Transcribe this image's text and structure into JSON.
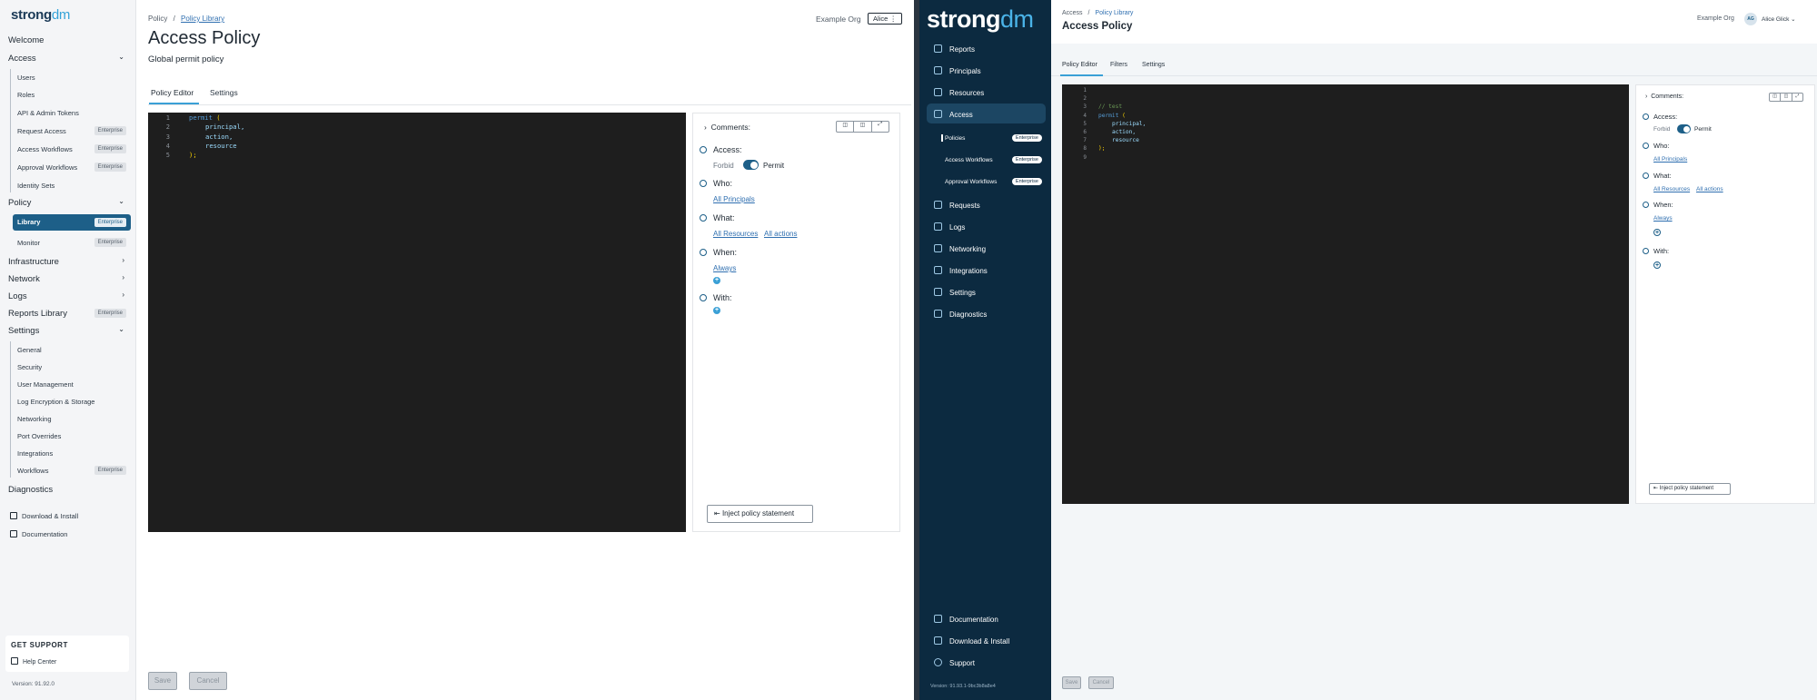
{
  "left": {
    "logo": {
      "a": "strong",
      "b": "dm"
    },
    "nav": {
      "welcome": "Welcome",
      "access": "Access",
      "access_items": [
        "Users",
        "Roles",
        "API & Admin Tokens",
        "Request Access",
        "Access Workflows",
        "Approval Workflows",
        "Identity Sets"
      ],
      "policy": "Policy",
      "policy_items": [
        "Library",
        "Monitor"
      ],
      "infrastructure": "Infrastructure",
      "network": "Network",
      "logs": "Logs",
      "reports_library": "Reports Library",
      "settings": "Settings",
      "settings_items": [
        "General",
        "Security",
        "User Management",
        "Log Encryption & Storage",
        "Networking",
        "Port Overrides",
        "Integrations",
        "Workflows"
      ],
      "diagnostics": "Diagnostics",
      "download": "Download & Install",
      "documentation": "Documentation",
      "enterprise": "Enterprise"
    },
    "support": {
      "title": "GET SUPPORT",
      "help": "Help Center"
    },
    "version": "Version: 91.92.0",
    "breadcrumb": {
      "root": "Policy",
      "sep": "/",
      "current": "Policy Library"
    },
    "org": "Example Org",
    "user": "Alice",
    "title": "Access Policy",
    "subtitle": "Global permit policy",
    "tabs": [
      "Policy Editor",
      "Settings"
    ],
    "code_lines": [
      "1",
      "2",
      "3",
      "4",
      "5"
    ],
    "panel": {
      "comments": "Comments:",
      "access": "Access:",
      "forbid": "Forbid",
      "permit": "Permit",
      "who": "Who:",
      "all_principals": "All Principals",
      "what": "What:",
      "all_resources": "All Resources",
      "all_actions": "All actions",
      "when": "When:",
      "always": "Always",
      "with": "With:",
      "inject": "Inject policy statement"
    },
    "save": "Save",
    "cancel": "Cancel"
  },
  "right": {
    "logo": {
      "a": "strong",
      "b": "dm"
    },
    "nav": [
      "Reports",
      "Principals",
      "Resources",
      "Access",
      "Requests",
      "Logs",
      "Networking",
      "Integrations",
      "Settings",
      "Diagnostics"
    ],
    "access_sub": {
      "policies": "Policies",
      "access_workflows": "Access Workflows",
      "approval_workflows": "Approval Workflows"
    },
    "enterprise": "Enterprise",
    "bottom_nav": [
      "Documentation",
      "Download & Install",
      "Support"
    ],
    "version": "Version: 91.93.1-9bc3b8a8e4",
    "breadcrumb": {
      "root": "Access",
      "sep": "/",
      "current": "Policy Library"
    },
    "org": "Example Org",
    "avatar": "AG",
    "user": "Alice Glick",
    "title": "Access Policy",
    "tabs": [
      "Policy Editor",
      "Filters",
      "Settings"
    ],
    "code_lines": [
      "1",
      "2",
      "3",
      "4",
      "5",
      "6",
      "7",
      "8",
      "9"
    ],
    "panel": {
      "comments": "Comments:",
      "access": "Access:",
      "forbid": "Forbid",
      "permit": "Permit",
      "who": "Who:",
      "all_principals": "All Principals",
      "what": "What:",
      "all_resources": "All Resources",
      "all_actions": "All actions",
      "when": "When:",
      "always": "Always",
      "with": "With:",
      "inject": "Inject policy statement"
    },
    "save": "Save",
    "cancel": "Cancel"
  },
  "code_left": {
    "l1a": "permit",
    "l1b": " (",
    "l2": "principal,",
    "l3": "action,",
    "l4": "resource",
    "l5": ");"
  },
  "code_right": {
    "l3": "// test",
    "l4a": "permit",
    "l4b": " (",
    "l5": "principal,",
    "l6": "action,",
    "l7": "resource",
    "l8": ");"
  }
}
